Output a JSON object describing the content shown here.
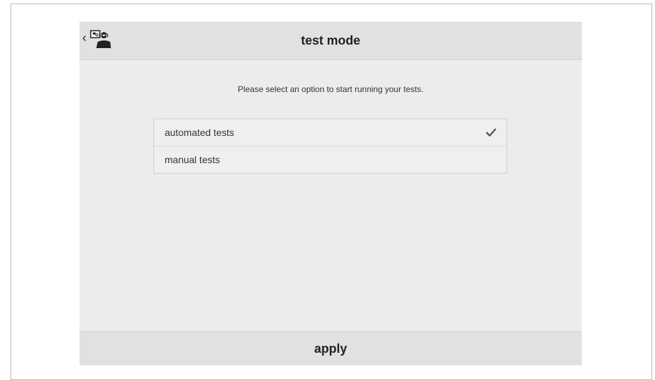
{
  "header": {
    "title": "test mode",
    "back_icon": "chevron-left-icon",
    "avatar_icon": "technician-icon"
  },
  "main": {
    "instruction": "Please select an option to start running your tests.",
    "options": [
      {
        "label": "automated tests",
        "selected": true
      },
      {
        "label": "manual tests",
        "selected": false
      }
    ],
    "selected_icon": "checkmark-icon"
  },
  "footer": {
    "apply_label": "apply"
  }
}
